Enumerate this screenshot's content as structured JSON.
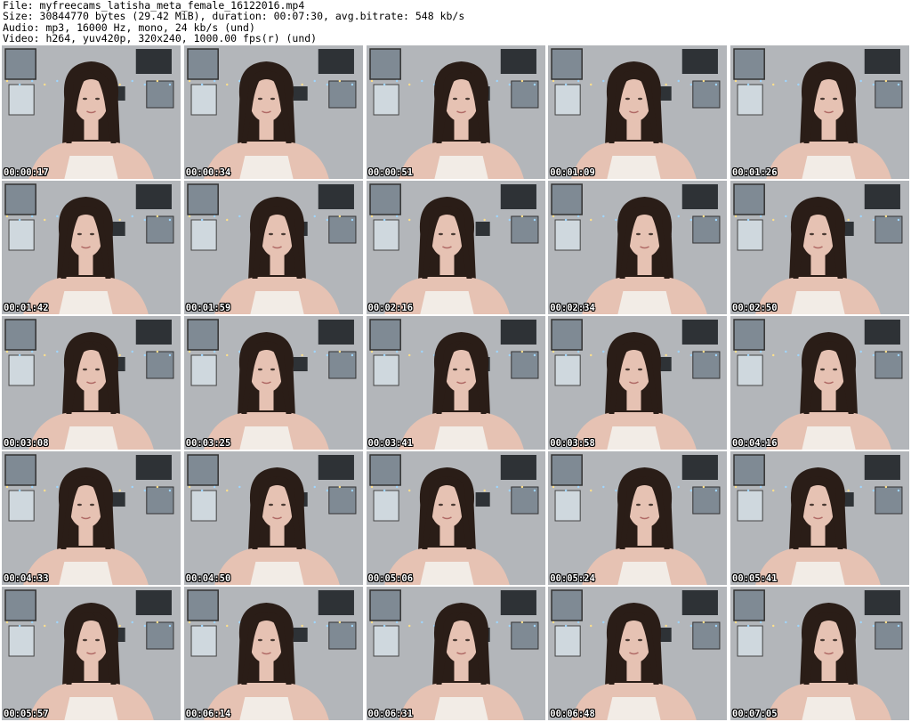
{
  "header": {
    "file": "File: myfreecams_latisha_meta_female_16122016.mp4",
    "size": "Size: 30844770 bytes (29.42 MiB), duration: 00:07:30, avg.bitrate: 548 kb/s",
    "audio": "Audio: mp3, 16000 Hz, mono, 24 kb/s (und)",
    "video": "Video: h264, yuv420p, 320x240, 1000.00 fps(r) (und)"
  },
  "colors": {
    "wall": "#b3b6ba",
    "hair": "#2a1d17",
    "skin": "#e6c2b3",
    "top": "#f2ece6",
    "frame": "#2e3236",
    "poster": "#7f8a94",
    "lights": "#9fd6ff"
  },
  "thumbnails": [
    {
      "time": "00:00:17",
      "icon": "video-frame-thumbnail"
    },
    {
      "time": "00:00:34",
      "icon": "video-frame-thumbnail"
    },
    {
      "time": "00:00:51",
      "icon": "video-frame-thumbnail"
    },
    {
      "time": "00:01:09",
      "icon": "video-frame-thumbnail"
    },
    {
      "time": "00:01:26",
      "icon": "video-frame-thumbnail"
    },
    {
      "time": "00:01:42",
      "icon": "video-frame-thumbnail"
    },
    {
      "time": "00:01:59",
      "icon": "video-frame-thumbnail"
    },
    {
      "time": "00:02:16",
      "icon": "video-frame-thumbnail"
    },
    {
      "time": "00:02:34",
      "icon": "video-frame-thumbnail"
    },
    {
      "time": "00:02:50",
      "icon": "video-frame-thumbnail"
    },
    {
      "time": "00:03:08",
      "icon": "video-frame-thumbnail"
    },
    {
      "time": "00:03:25",
      "icon": "video-frame-thumbnail"
    },
    {
      "time": "00:03:41",
      "icon": "video-frame-thumbnail"
    },
    {
      "time": "00:03:58",
      "icon": "video-frame-thumbnail"
    },
    {
      "time": "00:04:16",
      "icon": "video-frame-thumbnail"
    },
    {
      "time": "00:04:33",
      "icon": "video-frame-thumbnail"
    },
    {
      "time": "00:04:50",
      "icon": "video-frame-thumbnail"
    },
    {
      "time": "00:05:06",
      "icon": "video-frame-thumbnail"
    },
    {
      "time": "00:05:24",
      "icon": "video-frame-thumbnail"
    },
    {
      "time": "00:05:41",
      "icon": "video-frame-thumbnail"
    },
    {
      "time": "00:05:57",
      "icon": "video-frame-thumbnail"
    },
    {
      "time": "00:06:14",
      "icon": "video-frame-thumbnail"
    },
    {
      "time": "00:06:31",
      "icon": "video-frame-thumbnail"
    },
    {
      "time": "00:06:48",
      "icon": "video-frame-thumbnail"
    },
    {
      "time": "00:07:05",
      "icon": "video-frame-thumbnail"
    }
  ]
}
